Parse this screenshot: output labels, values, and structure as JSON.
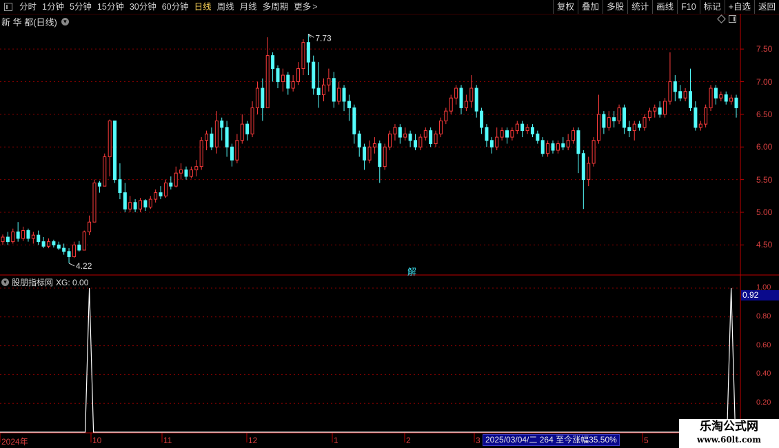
{
  "toolbar": {
    "period_tabs": [
      "分时",
      "1分钟",
      "5分钟",
      "15分钟",
      "30分钟",
      "60分钟",
      "日线",
      "周线",
      "月线",
      "多周期",
      "更多"
    ],
    "active_tab": "日线",
    "right_buttons": [
      "复权",
      "叠加",
      "多股",
      "统计",
      "画线",
      "F10",
      "标记",
      "+自选",
      "返回"
    ]
  },
  "main_chart": {
    "title": "新 华 都(日线)",
    "price_labels": [
      "7.50",
      "7.00",
      "6.50",
      "6.00",
      "5.50",
      "5.00",
      "4.50"
    ],
    "high_marker": "7.73",
    "low_marker": "4.22",
    "center_label": "解"
  },
  "indicator": {
    "name": "股朋指标网",
    "value_text": "XG: 0.00",
    "axis_labels": [
      "1.00",
      "0.80",
      "0.60",
      "0.40",
      "0.20"
    ],
    "current_value": "0.92"
  },
  "x_axis": {
    "labels": [
      "2024年",
      "10",
      "11",
      "12",
      "1",
      "2",
      "3",
      "5"
    ]
  },
  "info_bar": "2025/03/04/二 264 至今涨幅35.50%",
  "watermark": {
    "line1": "乐淘公式网",
    "line2": "www.60lt.com"
  },
  "colors": {
    "up": "#ff3c3c",
    "down": "#54fcfc",
    "grid": "#8c0000",
    "axis": "#c00000",
    "text": "#d0d0d0",
    "accent": "#ffd75a"
  },
  "chart_data": {
    "type": "candlestick",
    "y_range": [
      4.05,
      7.85
    ],
    "indicator_range": [
      0,
      1.0
    ],
    "candles": [
      [
        4.55,
        4.62,
        4.5,
        4.66
      ],
      [
        4.62,
        4.55,
        4.5,
        4.7
      ],
      [
        4.55,
        4.7,
        4.52,
        4.75
      ],
      [
        4.7,
        4.6,
        4.55,
        4.85
      ],
      [
        4.6,
        4.72,
        4.56,
        4.78
      ],
      [
        4.72,
        4.6,
        4.55,
        4.75
      ],
      [
        4.6,
        4.65,
        4.52,
        4.7
      ],
      [
        4.65,
        4.55,
        4.5,
        4.72
      ],
      [
        4.55,
        4.48,
        4.45,
        4.62
      ],
      [
        4.48,
        4.55,
        4.45,
        4.6
      ],
      [
        4.55,
        4.5,
        4.46,
        4.58
      ],
      [
        4.5,
        4.45,
        4.42,
        4.55
      ],
      [
        4.45,
        4.4,
        4.35,
        4.52
      ],
      [
        4.4,
        4.32,
        4.22,
        4.45
      ],
      [
        4.32,
        4.5,
        4.3,
        4.55
      ],
      [
        4.5,
        4.42,
        4.4,
        4.56
      ],
      [
        4.42,
        4.7,
        4.42,
        4.72
      ],
      [
        4.7,
        4.85,
        4.65,
        4.95
      ],
      [
        4.85,
        5.45,
        4.85,
        5.5
      ],
      [
        5.45,
        5.4,
        5.3,
        5.48
      ],
      [
        5.4,
        5.85,
        5.4,
        5.9
      ],
      [
        5.85,
        6.4,
        5.55,
        6.42
      ],
      [
        6.4,
        5.5,
        5.45,
        6.4
      ],
      [
        5.5,
        5.3,
        5.2,
        5.75
      ],
      [
        5.3,
        5.05,
        5.0,
        5.45
      ],
      [
        5.05,
        5.15,
        5.0,
        5.25
      ],
      [
        5.15,
        5.05,
        5.0,
        5.2
      ],
      [
        5.05,
        5.18,
        5.0,
        5.22
      ],
      [
        5.18,
        5.08,
        5.02,
        5.2
      ],
      [
        5.08,
        5.2,
        5.05,
        5.25
      ],
      [
        5.2,
        5.3,
        5.15,
        5.35
      ],
      [
        5.3,
        5.25,
        5.2,
        5.4
      ],
      [
        5.25,
        5.45,
        5.22,
        5.5
      ],
      [
        5.45,
        5.4,
        5.35,
        5.55
      ],
      [
        5.4,
        5.6,
        5.38,
        5.7
      ],
      [
        5.6,
        5.65,
        5.5,
        5.75
      ],
      [
        5.65,
        5.55,
        5.5,
        5.7
      ],
      [
        5.55,
        5.65,
        5.52,
        5.7
      ],
      [
        5.65,
        5.7,
        5.55,
        5.8
      ],
      [
        5.7,
        6.1,
        5.65,
        6.15
      ],
      [
        6.1,
        6.2,
        5.95,
        6.25
      ],
      [
        6.2,
        6.0,
        5.95,
        6.3
      ],
      [
        6.0,
        6.4,
        5.9,
        6.55
      ],
      [
        6.4,
        6.3,
        6.1,
        6.45
      ],
      [
        6.3,
        6.0,
        5.85,
        6.4
      ],
      [
        6.0,
        5.8,
        5.7,
        6.05
      ],
      [
        5.8,
        6.1,
        5.75,
        6.2
      ],
      [
        6.1,
        6.35,
        6.05,
        6.5
      ],
      [
        6.35,
        6.2,
        6.1,
        6.4
      ],
      [
        6.2,
        6.6,
        6.15,
        6.7
      ],
      [
        6.6,
        6.9,
        6.5,
        7.0
      ],
      [
        6.9,
        6.6,
        6.4,
        7.05
      ],
      [
        6.6,
        7.4,
        6.6,
        7.68
      ],
      [
        7.4,
        7.2,
        7.0,
        7.45
      ],
      [
        7.2,
        7.0,
        6.9,
        7.25
      ],
      [
        7.0,
        7.1,
        6.85,
        7.2
      ],
      [
        7.1,
        6.9,
        6.8,
        7.15
      ],
      [
        6.9,
        7.0,
        6.85,
        7.1
      ],
      [
        7.0,
        7.2,
        6.95,
        7.3
      ],
      [
        7.2,
        7.6,
        7.1,
        7.65
      ],
      [
        7.6,
        7.3,
        7.1,
        7.73
      ],
      [
        7.3,
        6.9,
        6.8,
        7.4
      ],
      [
        6.9,
        6.8,
        6.6,
        7.3
      ],
      [
        6.8,
        6.95,
        6.7,
        7.05
      ],
      [
        6.95,
        7.05,
        6.85,
        7.2
      ],
      [
        7.05,
        6.7,
        6.6,
        7.15
      ],
      [
        6.7,
        6.9,
        6.65,
        7.0
      ],
      [
        6.9,
        6.7,
        6.55,
        6.95
      ],
      [
        6.7,
        6.6,
        6.4,
        6.8
      ],
      [
        6.6,
        6.2,
        6.05,
        6.65
      ],
      [
        6.2,
        6.0,
        5.85,
        6.25
      ],
      [
        6.0,
        5.8,
        5.65,
        6.05
      ],
      [
        5.8,
        6.0,
        5.75,
        6.1
      ],
      [
        6.0,
        6.05,
        5.9,
        6.15
      ],
      [
        6.05,
        5.7,
        5.45,
        6.1
      ],
      [
        5.7,
        6.0,
        5.65,
        6.05
      ],
      [
        6.0,
        6.2,
        5.95,
        6.25
      ],
      [
        6.2,
        6.3,
        6.1,
        6.35
      ],
      [
        6.3,
        6.15,
        6.05,
        6.35
      ],
      [
        6.15,
        6.2,
        6.1,
        6.3
      ],
      [
        6.2,
        6.1,
        6.0,
        6.25
      ],
      [
        6.1,
        6.0,
        5.95,
        6.2
      ],
      [
        6.0,
        6.15,
        5.95,
        6.2
      ],
      [
        6.15,
        6.25,
        6.1,
        6.3
      ],
      [
        6.25,
        6.05,
        6.0,
        6.3
      ],
      [
        6.05,
        6.2,
        6.0,
        6.25
      ],
      [
        6.2,
        6.4,
        6.15,
        6.45
      ],
      [
        6.4,
        6.55,
        6.35,
        6.6
      ],
      [
        6.55,
        6.75,
        6.5,
        6.8
      ],
      [
        6.75,
        6.9,
        6.65,
        6.95
      ],
      [
        6.9,
        6.6,
        6.5,
        6.95
      ],
      [
        6.6,
        6.7,
        6.55,
        6.8
      ],
      [
        6.7,
        6.9,
        6.6,
        7.1
      ],
      [
        6.9,
        6.55,
        6.45,
        6.95
      ],
      [
        6.55,
        6.3,
        6.2,
        6.6
      ],
      [
        6.3,
        6.1,
        6.0,
        6.35
      ],
      [
        6.1,
        6.0,
        5.9,
        6.15
      ],
      [
        6.0,
        6.15,
        5.95,
        6.3
      ],
      [
        6.15,
        6.25,
        6.1,
        6.3
      ],
      [
        6.25,
        6.15,
        6.05,
        6.3
      ],
      [
        6.15,
        6.25,
        6.1,
        6.3
      ],
      [
        6.25,
        6.35,
        6.2,
        6.4
      ],
      [
        6.35,
        6.25,
        6.15,
        6.4
      ],
      [
        6.25,
        6.3,
        6.2,
        6.35
      ],
      [
        6.3,
        6.2,
        6.15,
        6.35
      ],
      [
        6.2,
        6.1,
        6.05,
        6.25
      ],
      [
        6.1,
        5.9,
        5.85,
        6.15
      ],
      [
        5.9,
        6.05,
        5.85,
        6.1
      ],
      [
        6.05,
        5.95,
        5.9,
        6.1
      ],
      [
        5.95,
        6.05,
        5.9,
        6.1
      ],
      [
        6.05,
        6.0,
        5.95,
        6.15
      ],
      [
        6.0,
        6.1,
        5.95,
        6.2
      ],
      [
        6.1,
        6.25,
        6.05,
        6.3
      ],
      [
        6.25,
        5.9,
        5.6,
        6.3
      ],
      [
        5.9,
        5.5,
        5.05,
        5.95
      ],
      [
        5.5,
        5.75,
        5.4,
        5.85
      ],
      [
        5.75,
        6.1,
        5.7,
        6.15
      ],
      [
        6.1,
        6.5,
        6.05,
        6.8
      ],
      [
        6.5,
        6.3,
        6.2,
        6.55
      ],
      [
        6.3,
        6.45,
        6.25,
        6.55
      ],
      [
        6.45,
        6.4,
        6.3,
        6.55
      ],
      [
        6.4,
        6.6,
        6.35,
        6.65
      ],
      [
        6.6,
        6.3,
        6.2,
        6.65
      ],
      [
        6.3,
        6.25,
        6.15,
        6.4
      ],
      [
        6.25,
        6.35,
        6.1,
        6.4
      ],
      [
        6.35,
        6.3,
        6.25,
        6.4
      ],
      [
        6.3,
        6.45,
        6.25,
        6.5
      ],
      [
        6.45,
        6.55,
        6.4,
        6.6
      ],
      [
        6.55,
        6.6,
        6.45,
        6.65
      ],
      [
        6.6,
        6.5,
        6.45,
        6.7
      ],
      [
        6.5,
        6.7,
        6.45,
        6.75
      ],
      [
        6.7,
        7.0,
        6.65,
        7.45
      ],
      [
        7.0,
        6.85,
        6.7,
        7.1
      ],
      [
        6.85,
        6.75,
        6.7,
        6.95
      ],
      [
        6.75,
        6.85,
        6.7,
        6.9
      ],
      [
        6.85,
        6.6,
        6.55,
        7.2
      ],
      [
        6.6,
        6.3,
        6.25,
        6.7
      ],
      [
        6.3,
        6.35,
        6.25,
        6.4
      ],
      [
        6.35,
        6.6,
        6.3,
        6.65
      ],
      [
        6.6,
        6.9,
        6.55,
        6.95
      ],
      [
        6.9,
        6.75,
        6.65,
        6.95
      ],
      [
        6.75,
        6.8,
        6.7,
        6.85
      ],
      [
        6.8,
        6.7,
        6.65,
        6.85
      ],
      [
        6.7,
        6.75,
        6.65,
        6.8
      ],
      [
        6.75,
        6.6,
        6.45,
        6.8
      ]
    ],
    "signals": [
      17,
      143
    ]
  }
}
